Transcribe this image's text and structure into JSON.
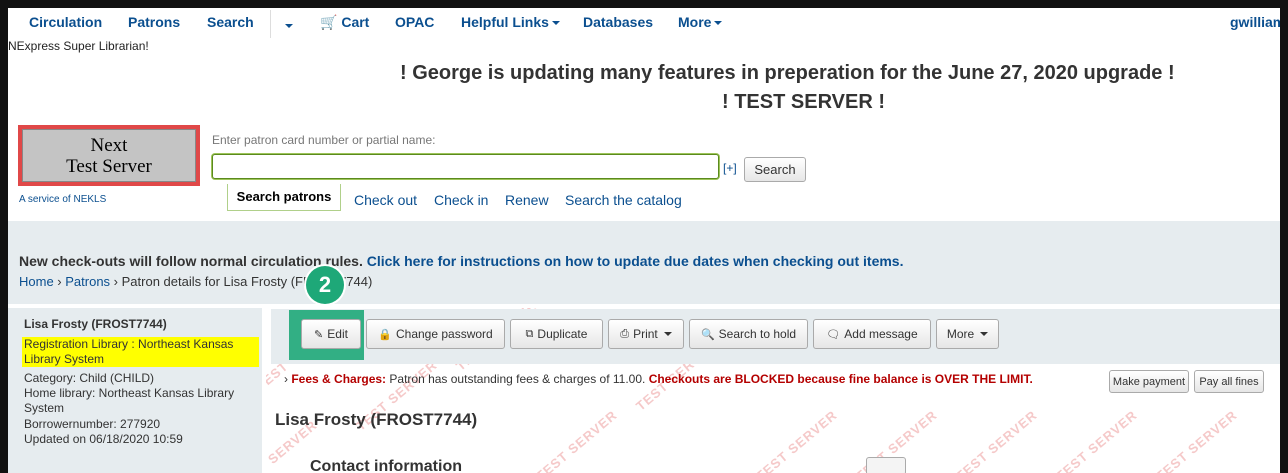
{
  "nav": {
    "circulation": "Circulation",
    "patrons": "Patrons",
    "search": "Search",
    "cart": "Cart",
    "opac": "OPAC",
    "helpful_links": "Helpful Links",
    "databases": "Databases",
    "more": "More",
    "user": "gwilliam",
    "user_title": "NExpress Super Librarian!"
  },
  "announcements": {
    "line1": "! George is updating many features in preperation for the June 27, 2020 upgrade !",
    "line2": "! TEST SERVER !"
  },
  "badge": {
    "line1": "Next",
    "line2": "Test Server",
    "service_link": "A service of NEKLS"
  },
  "search": {
    "label": "Enter patron card number or partial name:",
    "value": "",
    "advanced_toggle": "[+]",
    "button": "Search"
  },
  "subtabs": {
    "active": "Search patrons",
    "links": [
      "Check out",
      "Check in",
      "Renew",
      "Search the catalog"
    ]
  },
  "notice": {
    "text": "New check-outs will follow normal circulation rules.",
    "link": "Click here for instructions on how to update due dates when checking out items."
  },
  "breadcrumb": {
    "home": "Home",
    "patrons": "Patrons",
    "current": "Patron details for Lisa Frosty (FROST7744)"
  },
  "step_number": "2",
  "patron": {
    "name": "Lisa Frosty (FROST7744)",
    "registration": "Registration Library : Northeast Kansas Library System",
    "category": "Category: Child (CHILD)",
    "home_library": "Home library: Northeast Kansas Library System",
    "borrowernumber": "Borrowernumber: 277920",
    "updated": "Updated on 06/18/2020 10:59"
  },
  "toolbar": {
    "edit": "Edit",
    "change_password": "Change password",
    "duplicate": "Duplicate",
    "print": "Print",
    "search_to_hold": "Search to hold",
    "add_message": "Add message",
    "more": "More"
  },
  "fees": {
    "label": "Fees & Charges:",
    "text": "Patron has outstanding fees & charges of 11.00.",
    "blocked": "Checkouts are BLOCKED because fine balance is OVER THE LIMIT.",
    "make_payment": "Make payment",
    "pay_all": "Pay all fines"
  },
  "main": {
    "title": "Lisa Frosty (FROST7744)",
    "section": "Contact information"
  },
  "watermark": "TEST SERVER",
  "colors": {
    "link": "#0b4f8f",
    "accent_green": "#1ea878",
    "panel_bg": "#e6ecef",
    "highlight": "#ffff00",
    "alert": "#b40000"
  }
}
